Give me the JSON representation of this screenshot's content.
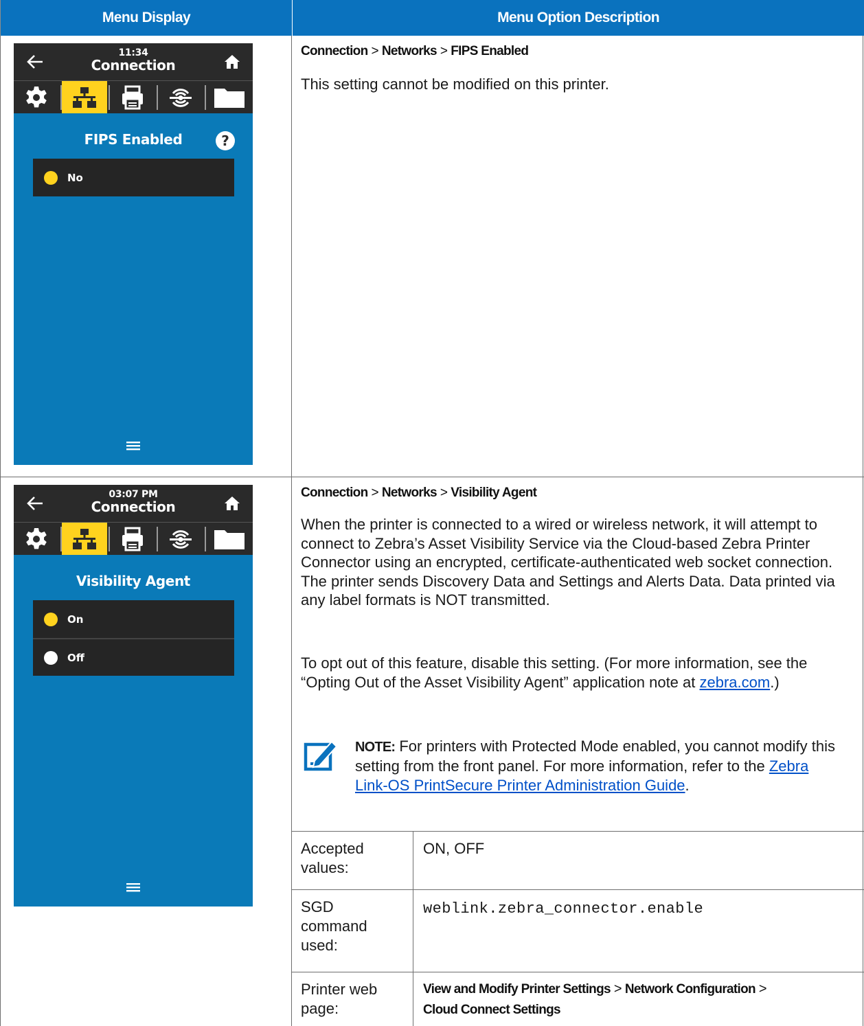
{
  "headers": {
    "menu_display": "Menu Display",
    "menu_option_description": "Menu Option Description"
  },
  "rows": [
    {
      "screen": {
        "time": "11:34",
        "title": "Connection",
        "heading": "FIPS Enabled",
        "options": [
          {
            "label": "No",
            "state": "selected"
          }
        ]
      },
      "path": [
        "Connection",
        "Networks",
        "FIPS Enabled"
      ],
      "path_separator": ">",
      "description": "This setting cannot be modified on this printer."
    },
    {
      "screen": {
        "time": "03:07 PM",
        "title": "Connection",
        "heading": "Visibility Agent",
        "options": [
          {
            "label": "On",
            "state": "selected"
          },
          {
            "label": "Off",
            "state": "unselected"
          }
        ]
      },
      "path": [
        "Connection",
        "Networks",
        "Visibility Agent"
      ],
      "path_separator": ">",
      "description": "When the printer is connected to a wired or wireless network, it will attempt to connect to Zebra’s Asset Visibility Service via the Cloud-based Zebra Printer Connector using an encrypted, certificate-authenticated web socket connection. The printer sends Discovery Data and Settings and Alerts Data. Data printed via any label formats is NOT transmitted.",
      "opt_out_text_before": "To opt out of this feature, disable this setting. (For more information, see the “Opting Out of the Asset Visibility Agent” application note at ",
      "opt_out_link": "zebra.com",
      "opt_out_text_after": ".)",
      "note": {
        "label": "NOTE:",
        "text": " For printers with Protected Mode enabled, you cannot modify this setting from the front panel. For more information, refer to the ",
        "link": "Zebra Link-OS PrintSecure Printer Administration Guide",
        "text_after": "."
      },
      "details": {
        "accepted_values_label": "Accepted values:",
        "accepted_values": "ON, OFF",
        "sgd_label": "SGD command used:",
        "sgd_command": "weblink.zebra_connector.enable",
        "web_label": "Printer web page:",
        "web_path": [
          "View and Modify Printer Settings",
          "Network Configuration",
          "Cloud Connect Settings"
        ]
      }
    }
  ],
  "colors": {
    "header_blue": "#0a72be",
    "screen_blue": "#0a7ab8",
    "selected_yellow": "#ffd21e",
    "link_blue": "#0050c8"
  },
  "icons": {
    "back": "back-arrow-icon",
    "home": "home-icon",
    "tabs": [
      "gear-icon",
      "network-icon",
      "printer-icon",
      "sensor-icon",
      "folder-icon"
    ],
    "help": "help-icon",
    "menu": "hamburger-menu-icon",
    "note": "note-pencil-icon"
  }
}
